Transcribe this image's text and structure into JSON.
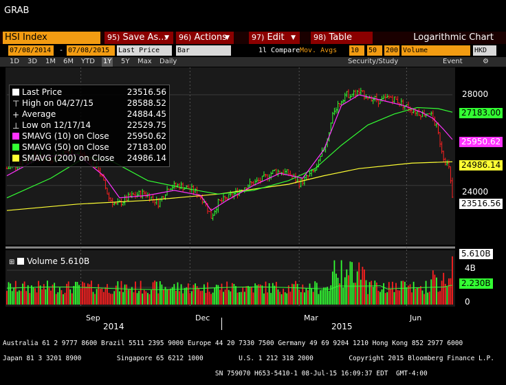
{
  "window": {
    "title": "GRAB"
  },
  "toolbar": {
    "ticker": "HSI Index",
    "save": {
      "num": "95)",
      "label": "Save As..."
    },
    "actions": {
      "num": "96)",
      "label": "Actions"
    },
    "edit": {
      "num": "97)",
      "label": "Edit"
    },
    "table": {
      "num": "98)",
      "label": "Table"
    },
    "chart_mode": "Logarithmic Chart"
  },
  "params": {
    "start_date": "07/08/2014",
    "dash": "-",
    "end_date": "07/08/2015",
    "field": "Last Price",
    "style": "Bar",
    "compare": "1l Compare",
    "mov_avgs": "Mov. Avgs",
    "ma1": "10",
    "ma2": "50",
    "ma3": "200",
    "lower": "Volume",
    "currency": "HKD"
  },
  "periods": [
    "1D",
    "3D",
    "1M",
    "6M",
    "YTD",
    "1Y",
    "5Y",
    "Max"
  ],
  "selected_period": "1Y",
  "frequency": "Daily",
  "security_study": "Security/Study",
  "event": "Event",
  "legend": [
    {
      "swatch": "box-white",
      "label": "Last Price",
      "value": "23516.56",
      "color": "#ffffff"
    },
    {
      "swatch": "high-icon",
      "label": "High on 04/27/15",
      "value": "28588.52",
      "color": "#ffffff"
    },
    {
      "swatch": "average-icon",
      "label": "Average",
      "value": "24884.45",
      "color": "#ffffff"
    },
    {
      "swatch": "low-icon",
      "label": "Low on 12/17/14",
      "value": "22529.75",
      "color": "#ffffff"
    },
    {
      "swatch": "box-magenta",
      "label": "SMAVG (10) on Close",
      "value": "25950.62",
      "color": "#ff33ff"
    },
    {
      "swatch": "box-green",
      "label": "SMAVG (50) on Close",
      "value": "27183.00",
      "color": "#33ff33"
    },
    {
      "swatch": "box-yellow",
      "label": "SMAVG (200) on Close",
      "value": "24986.14",
      "color": "#ffff33"
    }
  ],
  "price_axis": {
    "ticks": [
      "28000",
      "24000"
    ],
    "tags": [
      {
        "label": "27183.00",
        "bg": "#33ff33",
        "fg": "#000000"
      },
      {
        "label": "25950.62",
        "bg": "#ff33ff",
        "fg": "#ffffff"
      },
      {
        "label": "24986.14",
        "bg": "#ffff33",
        "fg": "#000000"
      },
      {
        "label": "23516.56",
        "bg": "#ffffff",
        "fg": "#000000"
      }
    ]
  },
  "volume": {
    "legend_label": "Volume",
    "legend_value": "5.610B",
    "ticks": [
      "4B",
      "2B",
      "0"
    ],
    "tags": [
      {
        "label": "5.610B",
        "bg": "#ffffff",
        "fg": "#000000"
      },
      {
        "label": "2.230B",
        "bg": "#33ff33",
        "fg": "#000000"
      }
    ]
  },
  "x_axis": {
    "months": [
      "Sep",
      "Dec",
      "Mar",
      "Jun"
    ],
    "years": [
      "2014",
      "2015"
    ]
  },
  "footer": [
    "Australia 61 2 9777 8600 Brazil 5511 2395 9000 Europe 44 20 7330 7500 Germany 49 69 9204 1210 Hong Kong 852 2977 6000",
    "Japan 81 3 3201 8900         Singapore 65 6212 1000         U.S. 1 212 318 2000         Copyright 2015 Bloomberg Finance L.P.",
    "                                                      SN 759070 H653-5410-1 08-Jul-15 16:09:37 EDT  GMT-4:00"
  ],
  "colors": {
    "sma10": "#ff33ff",
    "sma50": "#33ff33",
    "sma200": "#ffff33",
    "up": "#33ff33",
    "down": "#ff2020",
    "panel": "#1a1a1a"
  },
  "chart_data": {
    "type": "bar",
    "ohlc_path": [
      {
        "t": 0,
        "v": 24700
      },
      {
        "t": 8,
        "v": 24950
      },
      {
        "t": 16,
        "v": 25200
      },
      {
        "t": 24,
        "v": 25100
      },
      {
        "t": 34,
        "v": 25400
      },
      {
        "t": 44,
        "v": 25250
      },
      {
        "t": 52,
        "v": 24700
      },
      {
        "t": 58,
        "v": 23500
      },
      {
        "t": 62,
        "v": 23200
      },
      {
        "t": 70,
        "v": 23550
      },
      {
        "t": 78,
        "v": 23700
      },
      {
        "t": 86,
        "v": 23300
      },
      {
        "t": 92,
        "v": 23950
      },
      {
        "t": 98,
        "v": 24000
      },
      {
        "t": 106,
        "v": 23800
      },
      {
        "t": 112,
        "v": 23400
      },
      {
        "t": 116,
        "v": 22750
      },
      {
        "t": 120,
        "v": 23300
      },
      {
        "t": 128,
        "v": 23600
      },
      {
        "t": 136,
        "v": 24000
      },
      {
        "t": 144,
        "v": 24200
      },
      {
        "t": 152,
        "v": 24600
      },
      {
        "t": 160,
        "v": 24500
      },
      {
        "t": 166,
        "v": 24100
      },
      {
        "t": 170,
        "v": 24300
      },
      {
        "t": 176,
        "v": 24700
      },
      {
        "t": 182,
        "v": 26000
      },
      {
        "t": 186,
        "v": 27300
      },
      {
        "t": 192,
        "v": 28000
      },
      {
        "t": 200,
        "v": 28100
      },
      {
        "t": 206,
        "v": 27900
      },
      {
        "t": 212,
        "v": 27700
      },
      {
        "t": 218,
        "v": 27900
      },
      {
        "t": 224,
        "v": 27600
      },
      {
        "t": 230,
        "v": 27300
      },
      {
        "t": 236,
        "v": 27100
      },
      {
        "t": 240,
        "v": 27200
      },
      {
        "t": 244,
        "v": 26500
      },
      {
        "t": 248,
        "v": 25200
      },
      {
        "t": 251,
        "v": 24700
      },
      {
        "t": 253,
        "v": 23516.56
      }
    ],
    "sma10": [
      [
        0,
        24400
      ],
      [
        20,
        25200
      ],
      [
        40,
        25300
      ],
      [
        55,
        24400
      ],
      [
        64,
        23500
      ],
      [
        80,
        23600
      ],
      [
        95,
        23800
      ],
      [
        110,
        23600
      ],
      [
        116,
        23000
      ],
      [
        125,
        23400
      ],
      [
        140,
        24000
      ],
      [
        155,
        24500
      ],
      [
        168,
        24300
      ],
      [
        180,
        25500
      ],
      [
        190,
        27500
      ],
      [
        200,
        28000
      ],
      [
        215,
        27700
      ],
      [
        225,
        27500
      ],
      [
        235,
        27200
      ],
      [
        242,
        26900
      ],
      [
        248,
        26400
      ],
      [
        253,
        25950.62
      ]
    ],
    "sma50": [
      [
        0,
        23500
      ],
      [
        25,
        24300
      ],
      [
        45,
        25200
      ],
      [
        60,
        25000
      ],
      [
        80,
        24200
      ],
      [
        100,
        23900
      ],
      [
        120,
        23650
      ],
      [
        140,
        23800
      ],
      [
        160,
        24200
      ],
      [
        175,
        24700
      ],
      [
        190,
        25700
      ],
      [
        205,
        26600
      ],
      [
        220,
        27100
      ],
      [
        233,
        27400
      ],
      [
        245,
        27350
      ],
      [
        253,
        27183
      ]
    ],
    "sma200": [
      [
        0,
        23000
      ],
      [
        40,
        23250
      ],
      [
        80,
        23400
      ],
      [
        120,
        23650
      ],
      [
        160,
        24050
      ],
      [
        180,
        24400
      ],
      [
        200,
        24700
      ],
      [
        230,
        24930
      ],
      [
        253,
        24986.14
      ]
    ],
    "ylim": [
      21800,
      29200
    ],
    "yscale": "log",
    "volume_ylim": [
      0,
      6
    ],
    "volume_last": 5.61,
    "volume_sma": 2.23,
    "x_months": [
      {
        "label": "Sep",
        "t": 42
      },
      {
        "label": "Dec",
        "t": 104
      },
      {
        "label": "Mar",
        "t": 166
      },
      {
        "label": "Jun",
        "t": 227
      }
    ],
    "x_years": [
      {
        "label": "2014",
        "t": 55
      },
      {
        "label": "2015",
        "t": 187
      }
    ]
  }
}
